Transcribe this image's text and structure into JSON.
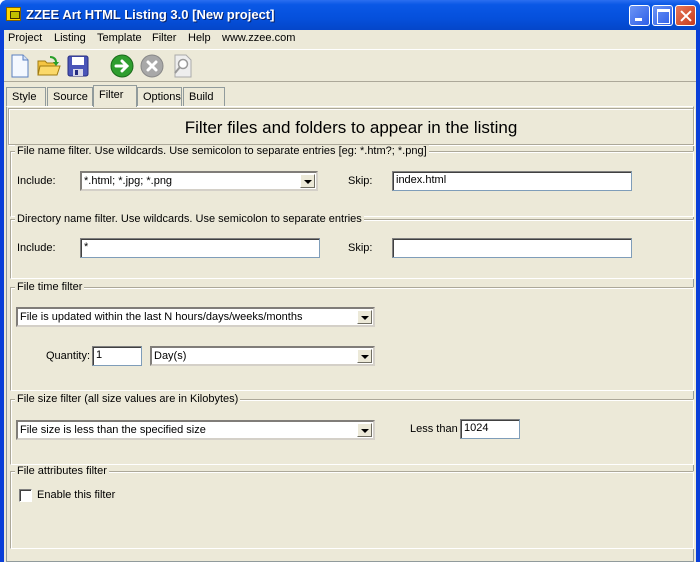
{
  "window": {
    "title": "ZZEE Art HTML Listing 3.0 [New project]",
    "controls": [
      "minimize",
      "maximize",
      "close"
    ]
  },
  "menubar": {
    "items": [
      {
        "label": "Project",
        "accel": "P"
      },
      {
        "label": "Listing",
        "accel": "L"
      },
      {
        "label": "Template",
        "accel": "T"
      },
      {
        "label": "Filter",
        "accel": "F"
      },
      {
        "label": "Help",
        "accel": "H"
      },
      {
        "label": "www.zzee.com",
        "accel": ""
      }
    ]
  },
  "toolbar": {
    "buttons": [
      {
        "icon": "new-document-icon",
        "enabled": true
      },
      {
        "icon": "open-folder-icon",
        "enabled": true
      },
      {
        "icon": "save-disk-icon",
        "enabled": true
      },
      {
        "icon": "go-arrow-icon",
        "enabled": true
      },
      {
        "icon": "stop-icon",
        "enabled": false
      },
      {
        "icon": "preview-magnifier-icon",
        "enabled": false
      }
    ]
  },
  "tabs": [
    {
      "label": "Style",
      "active": false
    },
    {
      "label": "Source",
      "active": false
    },
    {
      "label": "Filter",
      "active": true
    },
    {
      "label": "Options",
      "active": false
    },
    {
      "label": "Build",
      "active": false
    }
  ],
  "header": {
    "text": "Filter files and folders to appear in the listing"
  },
  "file_name_filter": {
    "legend": "File name filter. Use wildcards. Use semicolon to separate entries [eg: *.htm?; *.png]",
    "include_label": "Include:",
    "include_value": "*.html; *.jpg; *.png",
    "skip_label": "Skip:",
    "skip_value": "index.html"
  },
  "dir_name_filter": {
    "legend": "Directory name filter. Use wildcards. Use semicolon to separate entries",
    "include_label": "Include:",
    "include_value": "*",
    "skip_label": "Skip:",
    "skip_value": ""
  },
  "file_time_filter": {
    "legend": "File time filter",
    "mode_value": "File is updated within the last N hours/days/weeks/months",
    "quantity_label": "Quantity:",
    "quantity_value": "1",
    "unit_value": "Day(s)"
  },
  "file_size_filter": {
    "legend": "File size filter (all size values are in Kilobytes)",
    "mode_value": "File size is less than the specified size",
    "less_than_label": "Less than",
    "less_than_value": "1024"
  },
  "file_attr_filter": {
    "legend": "File attributes filter",
    "enable_label": "Enable this filter",
    "enabled": false
  }
}
